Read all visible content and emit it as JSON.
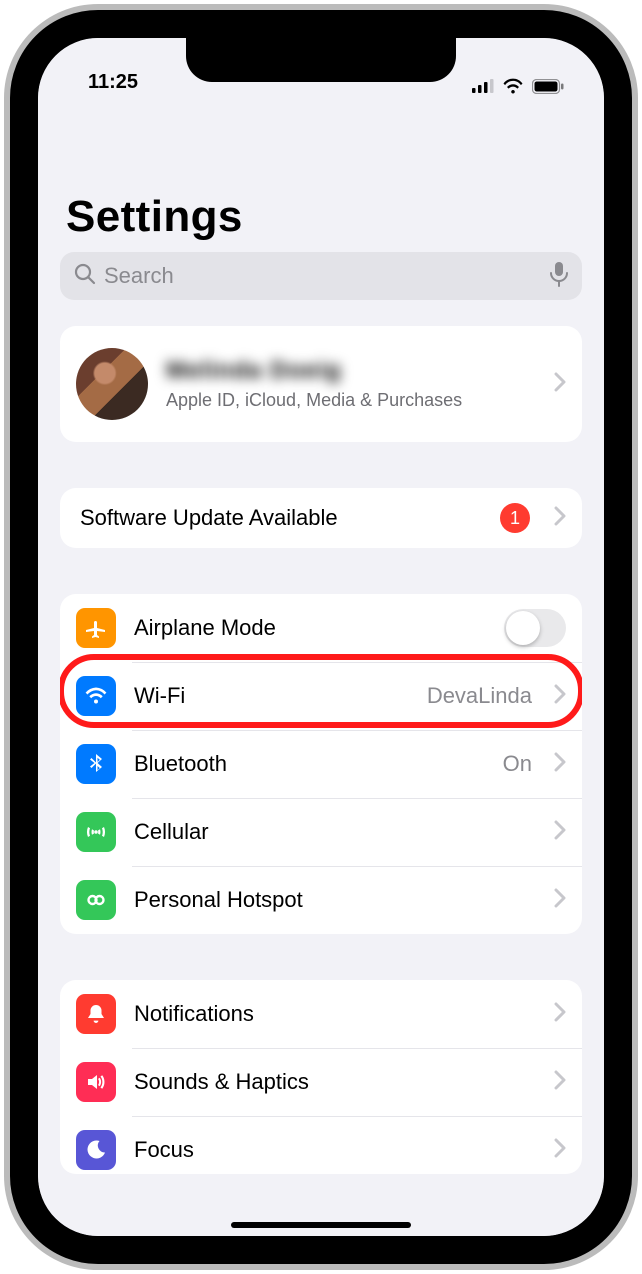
{
  "status": {
    "time": "11:25"
  },
  "header": {
    "title": "Settings"
  },
  "search": {
    "placeholder": "Search"
  },
  "account": {
    "name": "Melinda Doeig",
    "subtitle": "Apple ID, iCloud, Media & Purchases"
  },
  "update": {
    "label": "Software Update Available",
    "badge": "1"
  },
  "section_conn": {
    "airplane": {
      "label": "Airplane Mode",
      "on": false
    },
    "wifi": {
      "label": "Wi-Fi",
      "value": "DevaLinda"
    },
    "bluetooth": {
      "label": "Bluetooth",
      "value": "On"
    },
    "cellular": {
      "label": "Cellular"
    },
    "hotspot": {
      "label": "Personal Hotspot"
    }
  },
  "section_alerts": {
    "notifications": {
      "label": "Notifications"
    },
    "sounds": {
      "label": "Sounds & Haptics"
    },
    "focus": {
      "label": "Focus"
    }
  },
  "colors": {
    "accent_red": "#ff3b30",
    "highlight": "#ff1a1a"
  }
}
